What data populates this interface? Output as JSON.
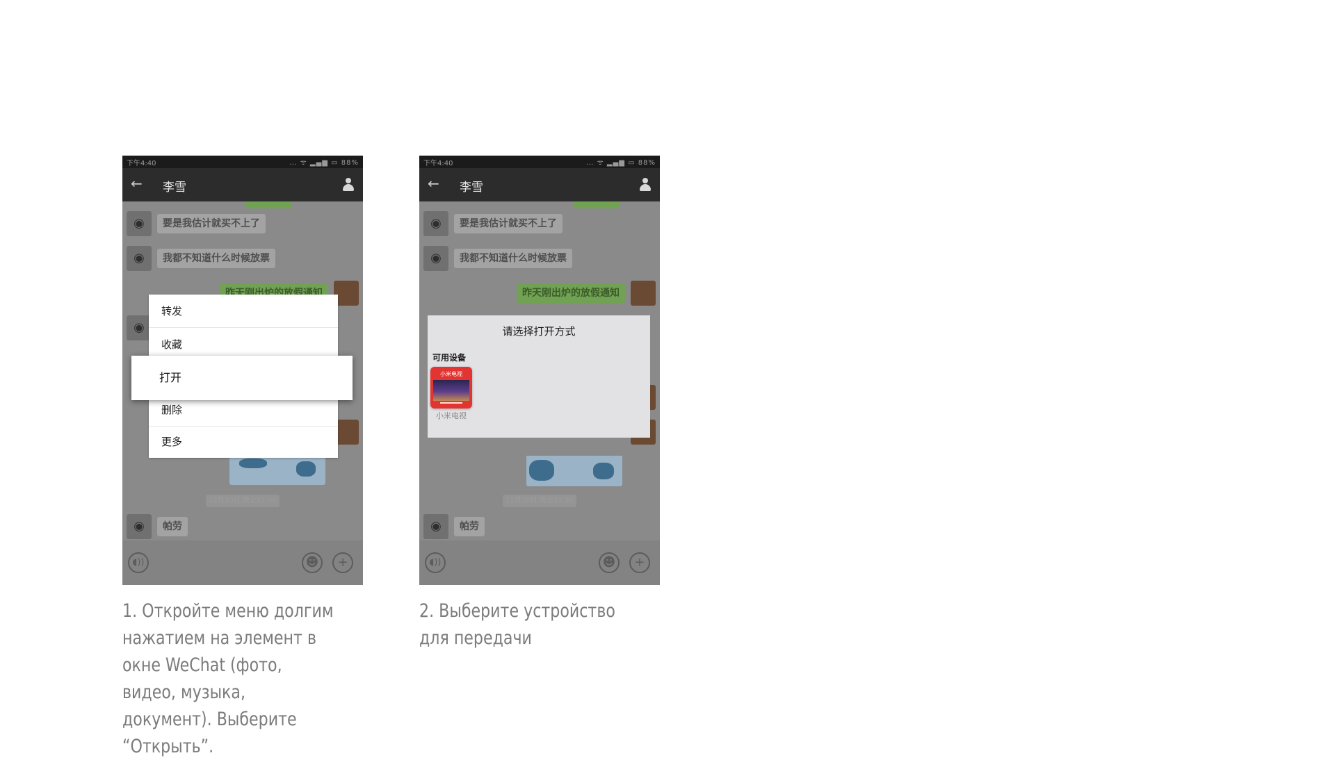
{
  "step1": {
    "phone": {
      "status_time": "下午4:40",
      "status_icons": "… ᯤ ▂▄▆ ▭ 88%",
      "chat_title": "李雪",
      "messages": [
        "要是我估计就买不上了",
        "我都不知道什么时候放票",
        "昨天刚出炉的放假通知",
        "帕劳"
      ],
      "timestamp": "12月20日 晚上21:30"
    },
    "context_menu": {
      "items": [
        "转发",
        "收藏",
        "打开",
        "删除",
        "更多"
      ],
      "highlighted": "打开"
    },
    "caption": "1. Откройте меню долгим нажатием на элемент в окне WeChat (фото, видео, музыка, документ). Выберите “Открыть”."
  },
  "step2": {
    "phone": {
      "status_time": "下午4:40",
      "status_icons": "… ᯤ ▂▄▆ ▭ 88%",
      "chat_title": "李雪",
      "messages": [
        "要是我估计就买不上了",
        "我都不知道什么时候放票",
        "昨天刚出炉的放假通知",
        "帕劳"
      ],
      "timestamp": "12月20日 晚上21:30"
    },
    "dialog": {
      "title": "请选择打开方式",
      "section": "可用设备",
      "device_badge": "小米电视",
      "device_name": "小米电视"
    },
    "caption": "2. Выберите устройство для передачи"
  },
  "icons": {
    "back": "arrow-left-icon",
    "contact": "person-icon",
    "voice": "voice-icon",
    "emoji": "emoji-icon",
    "add": "plus-icon"
  },
  "colors": {
    "overlay": "#8a8a8a",
    "wechat_green": "#71a254",
    "device_red": "#e23430",
    "caption": "#7b7b7b"
  }
}
